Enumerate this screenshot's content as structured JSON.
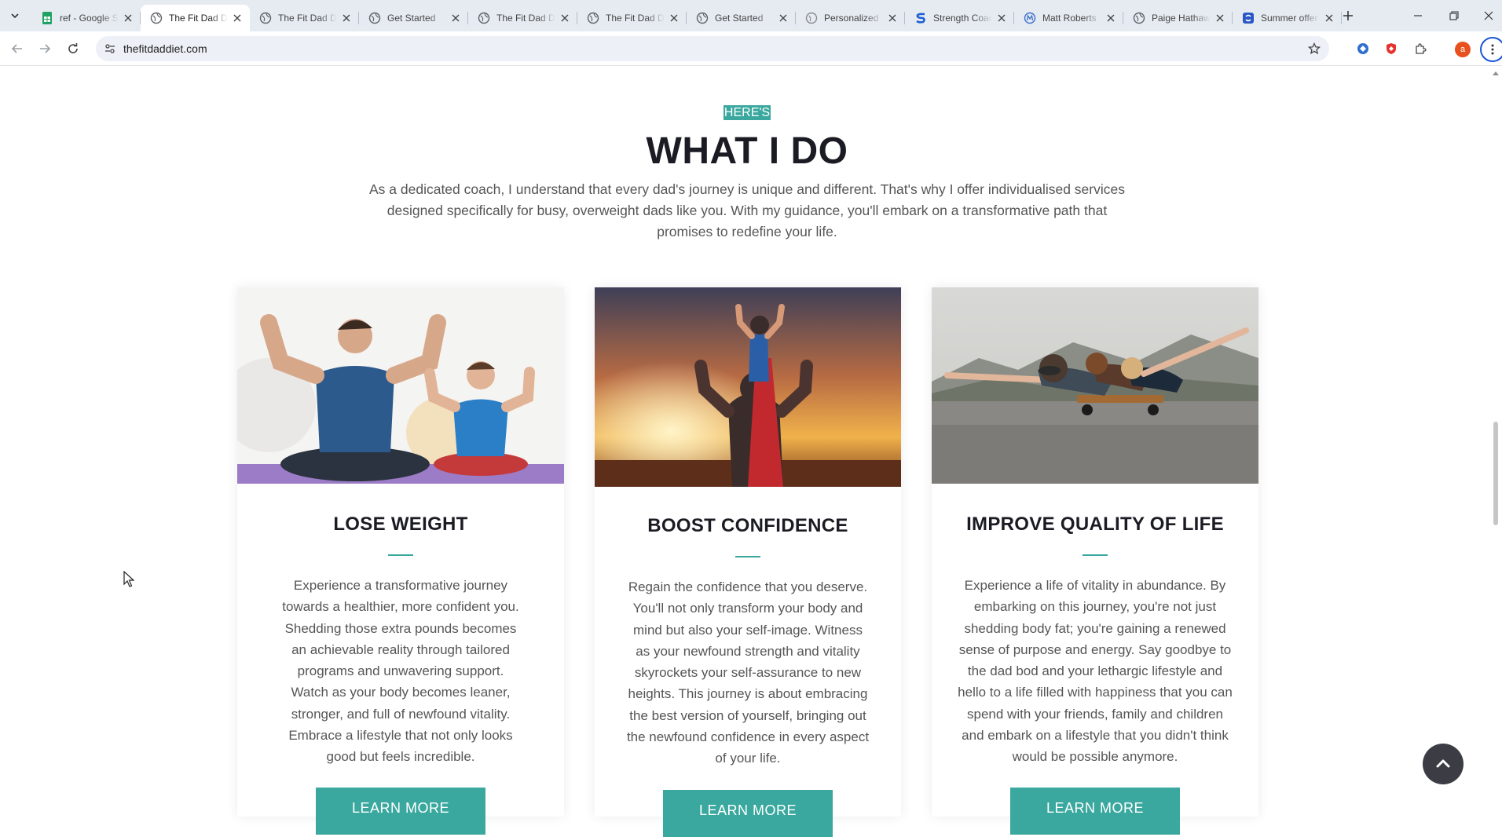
{
  "browser": {
    "tabs": [
      {
        "title": "ref - Google Sheets",
        "icon": "sheets-icon",
        "active": false
      },
      {
        "title": "The Fit Dad Diet",
        "icon": "globe-icon",
        "active": true
      },
      {
        "title": "The Fit Dad Diet",
        "icon": "globe-icon",
        "active": false
      },
      {
        "title": "Get Started",
        "icon": "globe-icon",
        "active": false
      },
      {
        "title": "The Fit Dad Diet",
        "icon": "globe-icon",
        "active": false
      },
      {
        "title": "The Fit Dad Diet",
        "icon": "globe-icon",
        "active": false
      },
      {
        "title": "Get Started",
        "icon": "globe-icon",
        "active": false
      },
      {
        "title": "Personalized",
        "icon": "globe-icon",
        "active": false
      },
      {
        "title": "Strength Coach",
        "icon": "s-logo-icon",
        "active": false
      },
      {
        "title": "Matt Roberts",
        "icon": "m-logo-icon",
        "active": false
      },
      {
        "title": "Paige Hathaway",
        "icon": "globe-icon",
        "active": false
      },
      {
        "title": "Summer offer",
        "icon": "blue-logo-icon",
        "active": false
      }
    ],
    "url": "thefitdaddiet.com",
    "profile_initial": "a"
  },
  "section": {
    "eyebrow": "HERE'S",
    "title": "WHAT I DO",
    "intro": "As a dedicated coach, I understand that every dad's journey is unique and different. That's why I offer individualised services designed specifically for busy, overweight dads like you. With my guidance, you'll embark on a transformative path that promises to redefine your life."
  },
  "cards": [
    {
      "title": "LOSE WEIGHT",
      "text": "Experience a transformative journey towards a healthier, more confident you. Shedding those extra pounds becomes an achievable reality through tailored programs and unwavering support. Watch as your body becomes leaner, stronger, and full of newfound vitality. Embrace a lifestyle that not only looks good but feels incredible.",
      "button": "LEARN MORE"
    },
    {
      "title": "BOOST CONFIDENCE",
      "text": "Regain the confidence that you deserve. You'll not only transform your body and mind but also your self-image. Witness as your newfound strength and vitality skyrockets your self-assurance to new heights. This journey is about embracing the best version of yourself, bringing out the newfound confidence in every aspect of your life.",
      "button": "LEARN MORE"
    },
    {
      "title": "IMPROVE QUALITY OF LIFE",
      "text": "Experience a life of vitality in abundance. By embarking on this journey, you're not just shedding body fat; you're gaining a renewed sense of purpose and energy. Say goodbye to the dad bod and your lethargic lifestyle and hello to a life filled with happiness that you can spend with your friends, family and children and embark on a lifestyle that you didn't think would be possible anymore.",
      "button": "LEARN MORE"
    }
  ],
  "colors": {
    "accent": "#3aa89e",
    "heading": "#1b1b24",
    "body_text": "#555555",
    "to_top_button": "#3c3c44"
  }
}
